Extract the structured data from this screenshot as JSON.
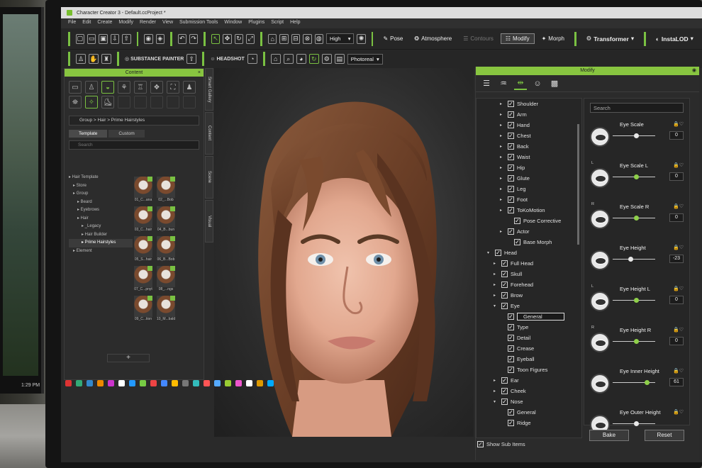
{
  "window": {
    "title": "Character Creator 3 - Default.ccProject *"
  },
  "menu": [
    "File",
    "Edit",
    "Create",
    "Modify",
    "Render",
    "View",
    "Submission Tools",
    "Window",
    "Plugins",
    "Script",
    "Help"
  ],
  "toolbar": {
    "quality": "High",
    "pose": "Pose",
    "atmosphere": "Atmosphere",
    "contours": "Contours",
    "modify": "Modify",
    "morph": "Morph",
    "transformer": "Transformer",
    "instalod": "InstaLOD"
  },
  "toolbar2": {
    "substance": "SUBSTANCE PAINTER",
    "headshot": "HEADSHOT",
    "render_mode": "Photoreal"
  },
  "content_panel": {
    "title": "Content",
    "breadcrumb": "Group > Hair > Prime Hairstyles",
    "tabs": [
      "Template",
      "Custom"
    ],
    "search_placeholder": "Search",
    "tree": [
      {
        "label": "Hair Template",
        "level": 0
      },
      {
        "label": "Store",
        "level": 1
      },
      {
        "label": "Group",
        "level": 1
      },
      {
        "label": "Beard",
        "level": 2
      },
      {
        "label": "Eyebrows",
        "level": 2
      },
      {
        "label": "Hair",
        "level": 2
      },
      {
        "label": "_Legacy",
        "level": 3
      },
      {
        "label": "Hair Builder",
        "level": 3
      },
      {
        "label": "Prime Hairstyles",
        "level": 3
      },
      {
        "label": "Element",
        "level": 1
      }
    ],
    "thumbs": [
      "01_C...ana",
      "02_...Bob",
      "03_C...hair",
      "04_B...bun",
      "05_S...hair",
      "06_B...Bob",
      "07_C...pnyt",
      "08_...ngs",
      "09_C...tion",
      "10_M...bald"
    ],
    "side_tabs": [
      "Smart Gallery",
      "Content",
      "Scene",
      "Visual"
    ]
  },
  "modify_panel": {
    "title": "Modify",
    "search_placeholder": "Search",
    "tree": [
      {
        "label": "Shoulder",
        "indent": 3,
        "arrow": "▸",
        "checked": true
      },
      {
        "label": "Arm",
        "indent": 3,
        "arrow": "▸",
        "checked": true
      },
      {
        "label": "Hand",
        "indent": 3,
        "arrow": "▸",
        "checked": true
      },
      {
        "label": "Chest",
        "indent": 3,
        "arrow": "▸",
        "checked": true
      },
      {
        "label": "Back",
        "indent": 3,
        "arrow": "▸",
        "checked": true
      },
      {
        "label": "Waist",
        "indent": 3,
        "arrow": "▸",
        "checked": true
      },
      {
        "label": "Hip",
        "indent": 3,
        "arrow": "▸",
        "checked": true
      },
      {
        "label": "Glute",
        "indent": 3,
        "arrow": "▸",
        "checked": true
      },
      {
        "label": "Leg",
        "indent": 3,
        "arrow": "▸",
        "checked": true
      },
      {
        "label": "Foot",
        "indent": 3,
        "arrow": "▸",
        "checked": true
      },
      {
        "label": "ToKoMotion",
        "indent": 3,
        "arrow": "▸",
        "checked": true
      },
      {
        "label": "Pose Corrective",
        "indent": 4,
        "arrow": "",
        "checked": true
      },
      {
        "label": "Actor",
        "indent": 3,
        "arrow": "▸",
        "checked": true
      },
      {
        "label": "Base Morph",
        "indent": 4,
        "arrow": "",
        "checked": true
      },
      {
        "label": "Head",
        "indent": 1,
        "arrow": "▾",
        "checked": true
      },
      {
        "label": "Full Head",
        "indent": 2,
        "arrow": "▸",
        "checked": true
      },
      {
        "label": "Skull",
        "indent": 2,
        "arrow": "▸",
        "checked": true
      },
      {
        "label": "Forehead",
        "indent": 2,
        "arrow": "▸",
        "checked": true
      },
      {
        "label": "Brow",
        "indent": 2,
        "arrow": "▸",
        "checked": true
      },
      {
        "label": "Eye",
        "indent": 2,
        "arrow": "▾",
        "checked": true
      },
      {
        "label": "General",
        "indent": 3,
        "arrow": "",
        "checked": true,
        "selected": true
      },
      {
        "label": "Type",
        "indent": 3,
        "arrow": "",
        "checked": true
      },
      {
        "label": "Detail",
        "indent": 3,
        "arrow": "",
        "checked": true
      },
      {
        "label": "Crease",
        "indent": 3,
        "arrow": "",
        "checked": true
      },
      {
        "label": "Eyeball",
        "indent": 3,
        "arrow": "",
        "checked": true
      },
      {
        "label": "Toon Figures",
        "indent": 3,
        "arrow": "",
        "checked": true
      },
      {
        "label": "Ear",
        "indent": 2,
        "arrow": "▸",
        "checked": true
      },
      {
        "label": "Cheek",
        "indent": 2,
        "arrow": "▸",
        "checked": true
      },
      {
        "label": "Nose",
        "indent": 2,
        "arrow": "▾",
        "checked": true
      },
      {
        "label": "General",
        "indent": 3,
        "arrow": "",
        "checked": true
      },
      {
        "label": "Ridge",
        "indent": 3,
        "arrow": "",
        "checked": true
      }
    ],
    "sliders": [
      {
        "label": "Eye Scale",
        "tag": "",
        "value": "0",
        "pos": 0.55,
        "green": false
      },
      {
        "label": "Eye Scale L",
        "tag": "L",
        "value": "0",
        "pos": 0.55,
        "green": true
      },
      {
        "label": "Eye Scale R",
        "tag": "R",
        "value": "0",
        "pos": 0.55,
        "green": true
      },
      {
        "label": "Eye Height",
        "tag": "",
        "value": "-23",
        "pos": 0.42,
        "green": false
      },
      {
        "label": "Eye Height L",
        "tag": "L",
        "value": "0",
        "pos": 0.55,
        "green": true
      },
      {
        "label": "Eye Height R",
        "tag": "R",
        "value": "0",
        "pos": 0.55,
        "green": true
      },
      {
        "label": "Eye Inner Height",
        "tag": "",
        "value": "61",
        "pos": 0.8,
        "green": true
      },
      {
        "label": "Eye Outer Height",
        "tag": "",
        "value": "",
        "pos": 0.55,
        "green": false
      }
    ],
    "bake": "Bake",
    "reset": "Reset",
    "show_sub_items": "Show Sub Items"
  },
  "left_monitor": {
    "clock": "1:29 PM"
  },
  "colors": {
    "accent": "#7ac142",
    "panel": "#2b2b2b",
    "background": "#262626"
  }
}
